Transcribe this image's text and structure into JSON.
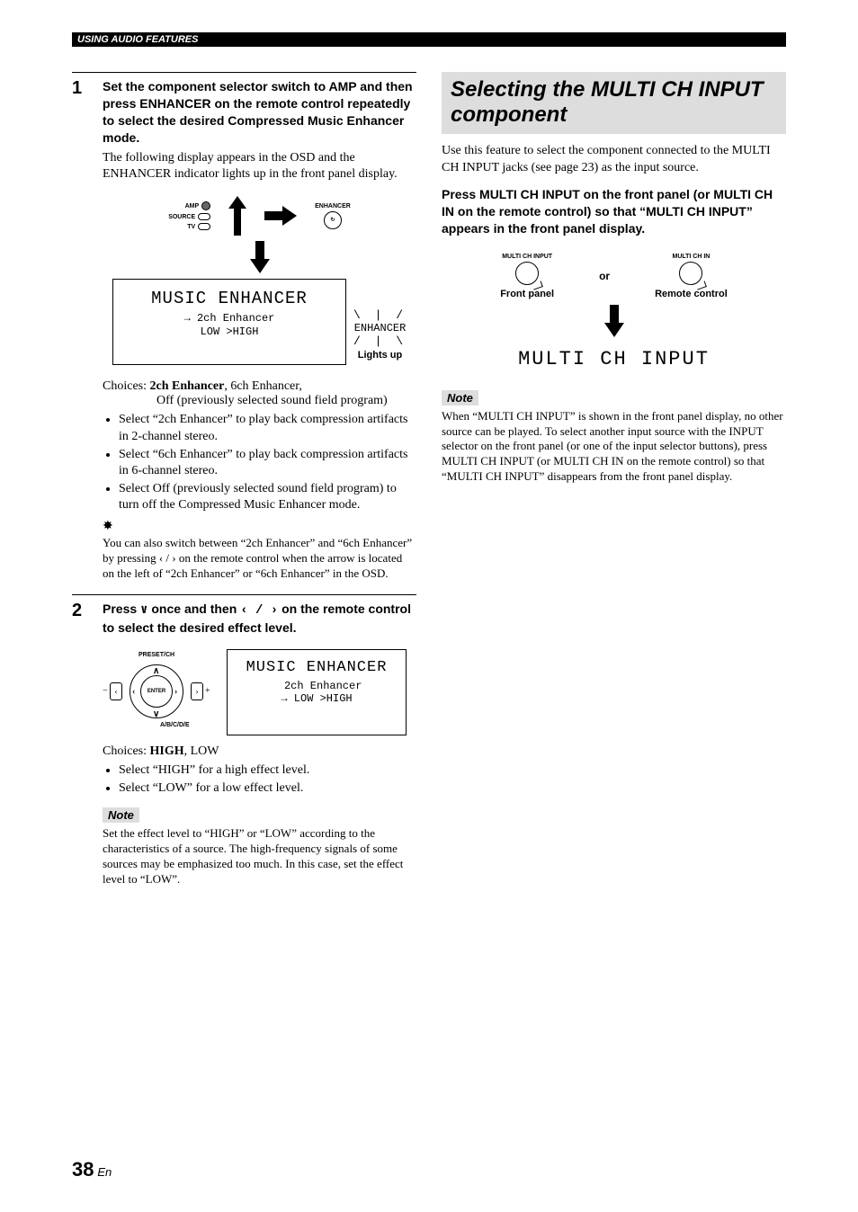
{
  "header": {
    "section": "USING AUDIO FEATURES"
  },
  "left": {
    "step1": {
      "num": "1",
      "head": "Set the component selector switch to AMP and then press ENHANCER on the remote control repeatedly to select the desired Compressed Music Enhancer mode.",
      "body": "The following display appears in the OSD and the ENHANCER indicator lights up in the front panel display.",
      "switch": {
        "amp": "AMP",
        "source": "SOURCE",
        "tv": "TV"
      },
      "enhancer_btn": "ENHANCER",
      "display": {
        "title": "MUSIC ENHANCER",
        "line1": "2ch Enhancer",
        "line2": "LOW  >HIGH"
      },
      "indicator": "ENHANCER",
      "lights_up": "Lights up",
      "choices_label": "Choices:",
      "choices_bold": "2ch Enhancer",
      "choices_rest": ", 6ch Enhancer,",
      "choices_sub": "Off (previously selected sound field program)",
      "bullets": [
        "Select “2ch Enhancer” to play back compression artifacts in 2-channel stereo.",
        "Select “6ch Enhancer” to play back compression artifacts in 6-channel stereo.",
        "Select Off (previously selected sound field program) to turn off the Compressed Music Enhancer mode."
      ],
      "tip": "You can also switch between “2ch Enhancer” and “6ch Enhancer” by pressing ‹ / › on the remote control when the arrow is located on the left of “2ch Enhancer” or “6ch Enhancer” in the OSD."
    },
    "step2": {
      "num": "2",
      "head_pre": "Press ",
      "head_mid": " once and then ",
      "head_post": " on the remote control to select the desired effect level.",
      "pad": {
        "top": "PRESET/CH",
        "bottom": "A/B/C/D/E",
        "enter": "ENTER"
      },
      "display": {
        "title": "MUSIC ENHANCER",
        "line1": "2ch Enhancer",
        "line2": "LOW  >HIGH"
      },
      "choices_label": "Choices:",
      "choices_bold": "HIGH",
      "choices_rest": ", LOW",
      "bullets": [
        "Select “HIGH” for a high effect level.",
        "Select “LOW” for a low effect level."
      ],
      "note_label": "Note",
      "note": "Set the effect level to “HIGH” or “LOW” according to the characteristics of a source. The high-frequency signals of some sources may be emphasized too much. In this case, set the effect level to “LOW”."
    }
  },
  "right": {
    "title": "Selecting the MULTI CH INPUT component",
    "intro": "Use this feature to select the component connected to the MULTI CH INPUT jacks (see page 23) as the input source.",
    "instruct": "Press MULTI CH INPUT on the front panel (or MULTI CH IN on the remote control) so that “MULTI CH INPUT” appears in the front panel display.",
    "btn_front": "MULTI CH INPUT",
    "btn_remote": "MULTI CH IN",
    "or": "or",
    "cap_front": "Front panel",
    "cap_remote": "Remote control",
    "display": "MULTI CH INPUT",
    "note_label": "Note",
    "note": "When “MULTI CH INPUT” is shown in the front panel display, no other source can be played. To select another input source with the INPUT selector on the front panel (or one of the input selector buttons), press MULTI CH INPUT (or MULTI CH IN on the remote control) so that “MULTI CH INPUT” disappears from the front panel display."
  },
  "page": {
    "num": "38",
    "suffix": "En"
  }
}
